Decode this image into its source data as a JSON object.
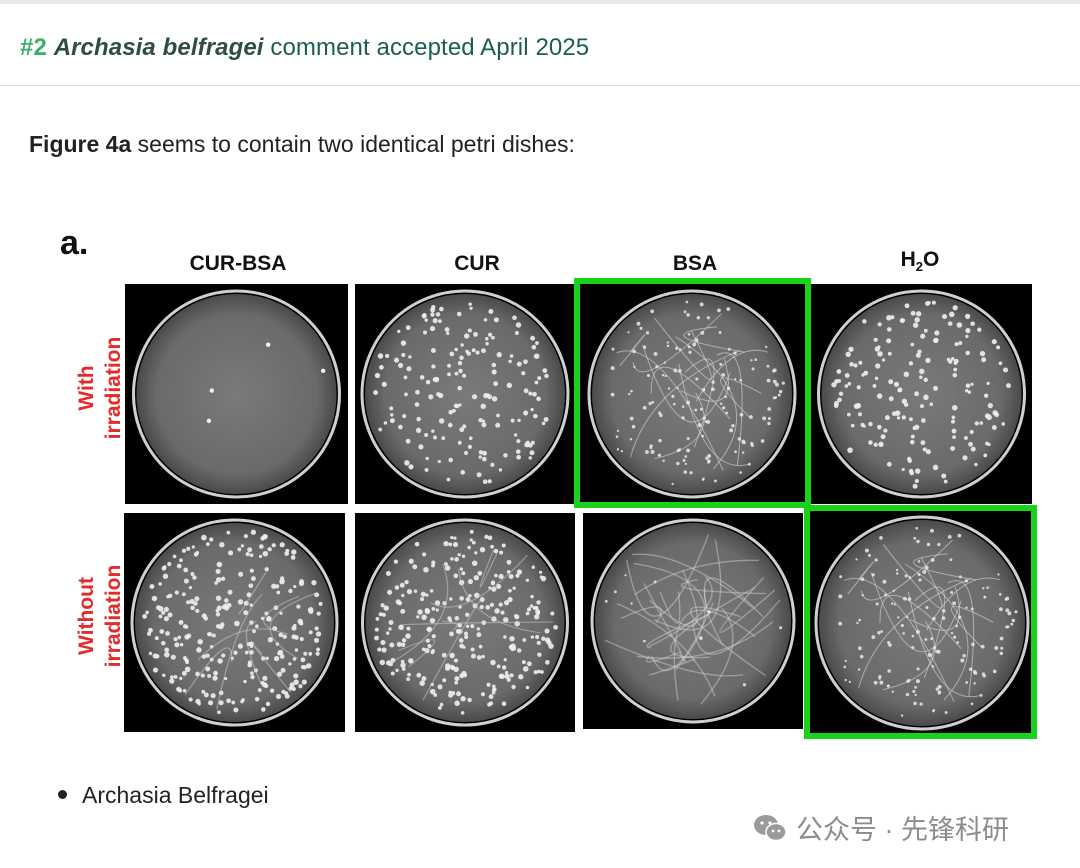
{
  "header": {
    "number": "#2",
    "species": "Archasia belfragei",
    "text": " comment accepted April 2025"
  },
  "intro": {
    "bold": "Figure 4a",
    "text": " seems to contain two identical petri dishes:"
  },
  "figure": {
    "panel_letter": "a.",
    "columns": [
      {
        "name": "CUR-BSA"
      },
      {
        "name": "CUR"
      },
      {
        "name": "BSA"
      },
      {
        "name": "H",
        "sub": "2",
        "suffix": "O"
      }
    ],
    "rows": [
      {
        "line1": "With",
        "line2": "irradiation"
      },
      {
        "line1": "Without",
        "line2": "irradiation"
      }
    ],
    "highlight_color": "#19d31a",
    "label_color": "#e52a2a"
  },
  "list": {
    "items": [
      "Archasia Belfragei"
    ]
  },
  "watermark": {
    "text": "公众号 · 先锋科研"
  }
}
